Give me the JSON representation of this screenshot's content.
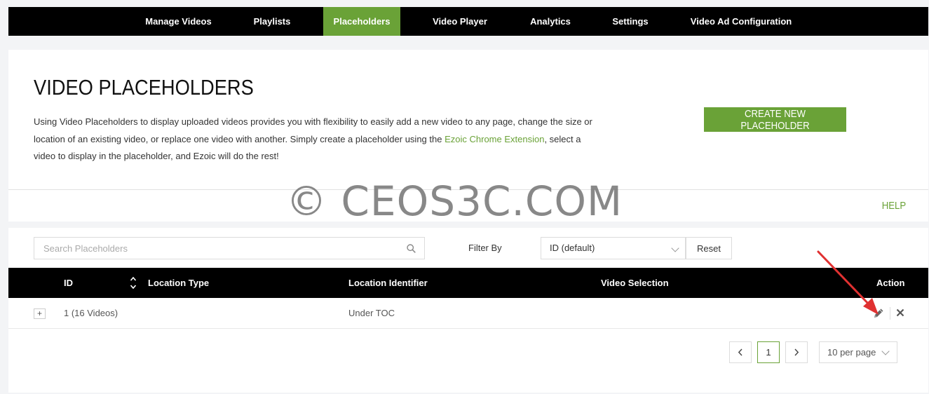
{
  "nav": {
    "items": [
      {
        "label": "Manage Videos"
      },
      {
        "label": "Playlists"
      },
      {
        "label": "Placeholders"
      },
      {
        "label": "Video Player"
      },
      {
        "label": "Analytics"
      },
      {
        "label": "Settings"
      },
      {
        "label": "Video Ad Configuration"
      }
    ],
    "active": "Placeholders"
  },
  "header": {
    "title": "VIDEO PLACEHOLDERS",
    "description_part1": "Using Video Placeholders to display uploaded videos provides you with flexibility to easily add a new video to any page, change the size or location of an existing video, or replace one video with another. Simply create a placeholder using the ",
    "description_link": "Ezoic Chrome Extension",
    "description_part2": ", select a video to display in the placeholder, and Ezoic will do the rest!",
    "create_button": "CREATE NEW PLACEHOLDER",
    "help_link": "HELP"
  },
  "watermark": "© CEOS3C.COM",
  "toolbar": {
    "search_placeholder": "Search Placeholders",
    "filter_label": "Filter By",
    "filter_value": "ID (default)",
    "reset_label": "Reset"
  },
  "table": {
    "columns": {
      "id": "ID",
      "location_type": "Location Type",
      "location_identifier": "Location Identifier",
      "video_selection": "Video Selection",
      "action": "Action"
    },
    "rows": [
      {
        "expand": "+",
        "id": "1 (16 Videos)",
        "location_type": "",
        "location_identifier": "Under TOC",
        "video_selection": ""
      }
    ]
  },
  "pagination": {
    "current_page": "1",
    "per_page": "10 per page"
  },
  "colors": {
    "accent": "#6aa237",
    "nav_bg": "#000000",
    "annotation_arrow": "#e03131"
  },
  "icons": {
    "search": "search-icon",
    "sort": "sort-icon",
    "edit": "pencil-icon",
    "delete": "close-icon",
    "prev": "chevron-left-icon",
    "next": "chevron-right-icon"
  }
}
